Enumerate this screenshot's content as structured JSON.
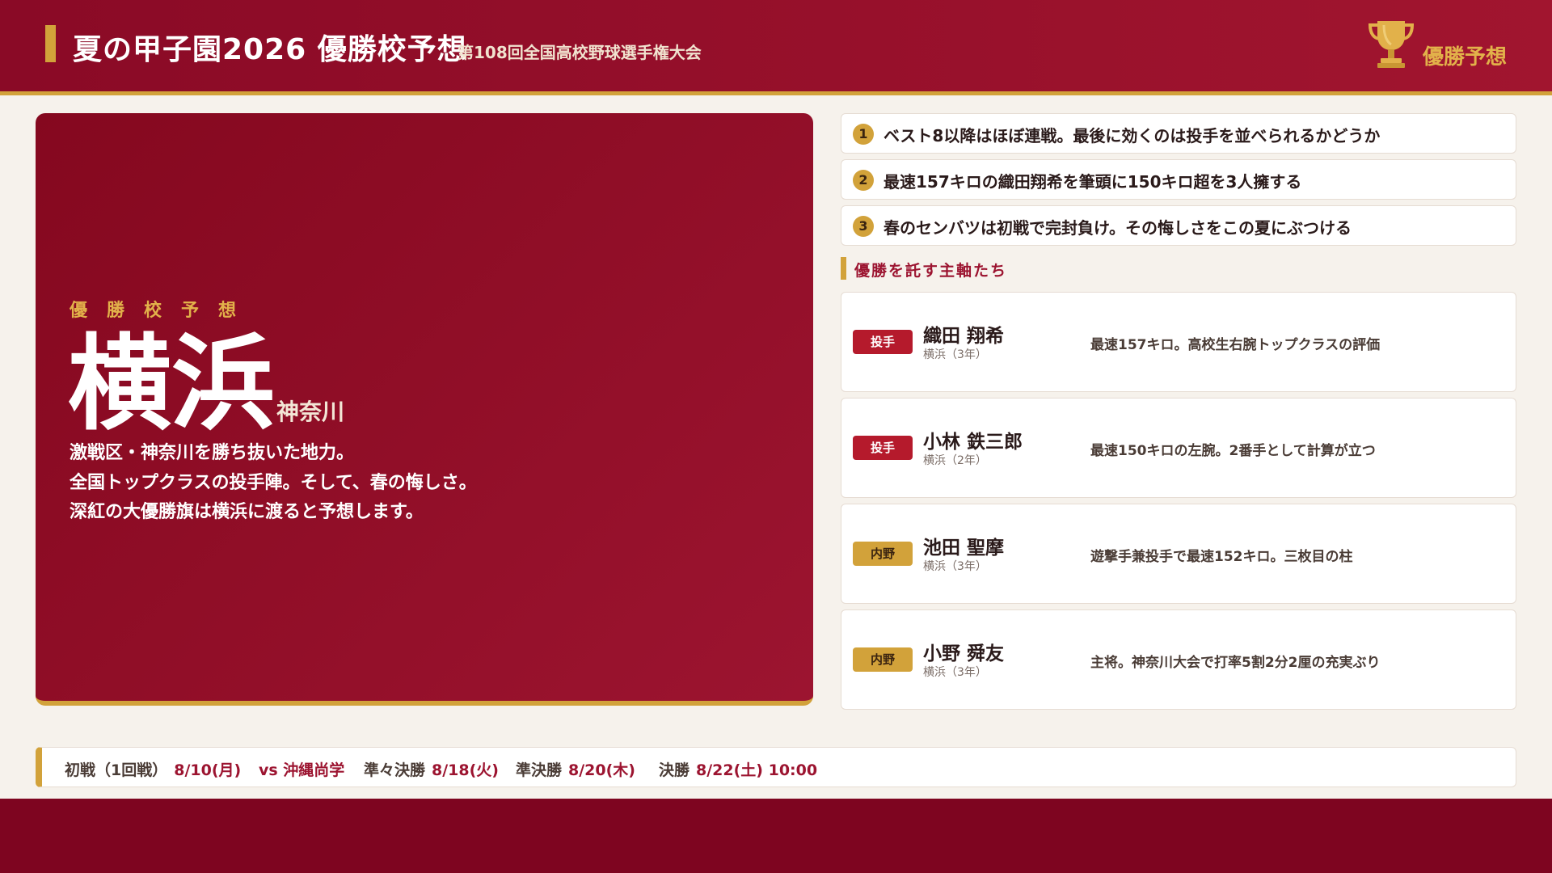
{
  "header": {
    "title": "夏の甲子園2026 優勝校予想",
    "subtitle": "第108回全国高校野球選手権大会",
    "badge": "優勝予想",
    "trophy_icon": "trophy-icon"
  },
  "hero": {
    "kicker": "優勝校予想",
    "school": "横浜",
    "prefecture": "神奈川",
    "lines": [
      "激戦区・神奈川を勝ち抜いた地力。",
      "全国トップクラスの投手陣。そして、春の悔しさ。",
      "深紅の大優勝旗は横浜に渡ると予想します。"
    ]
  },
  "points": [
    {
      "num": "1",
      "text": "ベスト8以降はほぼ連戦。最後に効くのは投手を並べられるかどうか"
    },
    {
      "num": "2",
      "text": "最速157キロの織田翔希を筆頭に150キロ超を3人擁する"
    },
    {
      "num": "3",
      "text": "春のセンバツは初戦で完封負け。その悔しさをこの夏にぶつける"
    }
  ],
  "players_section": {
    "title": "優勝を託す主軸たち"
  },
  "players": [
    {
      "position": "投手",
      "name": "織田 翔希",
      "team": "横浜（3年）",
      "desc": "最速157キロ。高校生右腕トップクラスの評価"
    },
    {
      "position": "投手",
      "name": "小林 鉄三郎",
      "team": "横浜（2年）",
      "desc": "最速150キロの左腕。2番手として計算が立つ"
    },
    {
      "position": "内野",
      "name": "池田 聖摩",
      "team": "横浜（3年）",
      "desc": "遊撃手兼投手で最速152キロ。三枚目の柱"
    },
    {
      "position": "内野",
      "name": "小野 舜友",
      "team": "横浜（3年）",
      "desc": "主将。神奈川大会で打率5割2分2厘の充実ぶり"
    }
  ],
  "schedule": [
    {
      "label": "初戦（1回戦）",
      "value": "8/10(月)"
    },
    {
      "label": "vs 沖縄尚学",
      "value": ""
    },
    {
      "label": "準々決勝",
      "value": "8/18(火)"
    },
    {
      "label": "準決勝",
      "value": "8/20(木)"
    },
    {
      "label": "決勝",
      "value": "8/22(土) 10:00"
    }
  ],
  "colors": {
    "crimson": "#8a0a26",
    "gold": "#d2a23a",
    "background": "#f6f2ec"
  }
}
